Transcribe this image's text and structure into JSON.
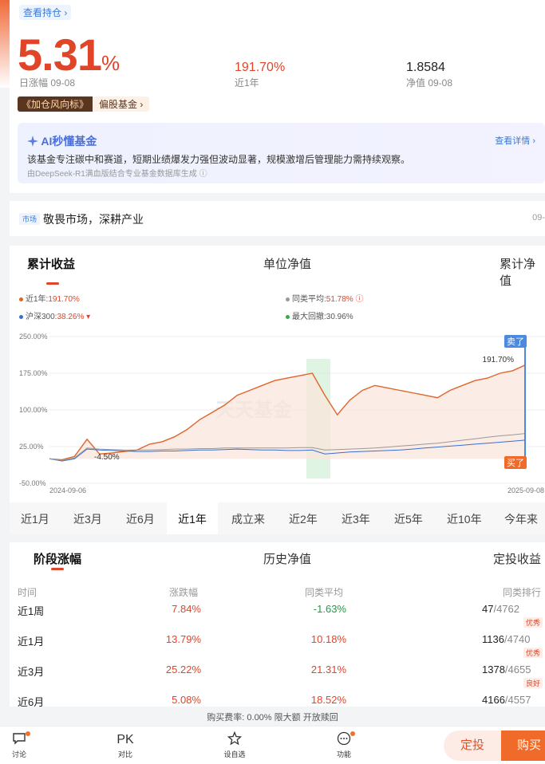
{
  "summary": {
    "view_holding": "查看持仓 ›",
    "daily_change": "5.31",
    "daily_change_unit": "%",
    "daily_label": "日涨幅 09-08",
    "year_return": "191.70%",
    "year_label": "近1年",
    "nav": "1.8584",
    "nav_label": "净值 09-08",
    "tag_dark": "《加仓风向标》",
    "tag_light": "偏股基金 ›"
  },
  "ai": {
    "title": "AI秒懂基金",
    "detail": "查看详情 ›",
    "text": "该基金专注碳中和赛道，短期业绩爆发力强但波动显著，规模激增后管理能力需持续观察。",
    "source": "由DeepSeek-R1满血版结合专业基金数据库生成 ⓘ"
  },
  "topic": {
    "tag": "市场",
    "text": "敬畏市场，深耕产业",
    "date": "09-"
  },
  "chart_tabs": [
    "累计收益",
    "单位净值",
    "累计净值"
  ],
  "legend": {
    "fund": "近1年:",
    "fund_val": "191.70%",
    "peer": "同类平均:",
    "peer_val": "51.78% ⓘ",
    "index": "沪深300:",
    "index_val": "38.26% ▾",
    "drawdown": "最大回撤:",
    "drawdown_val": "30.96%"
  },
  "chart_labels": {
    "sell": "卖了",
    "buy": "买了",
    "end_value": "191.70%",
    "low_value": "-4.50%",
    "watermark": "天天基金",
    "x_start": "2024-09-06",
    "x_end": "2025-09-08"
  },
  "chart_data": {
    "type": "line",
    "x": [
      "2024-09-06",
      "2025-09-08"
    ],
    "ylim": [
      -50,
      250
    ],
    "y_ticks": [
      "250.00%",
      "175.00%",
      "100.00%",
      "25.00%",
      "-50.00%"
    ],
    "series": [
      {
        "name": "近1年",
        "color": "#e0652a",
        "values": [
          0,
          -2,
          5,
          40,
          10,
          12,
          15,
          18,
          30,
          35,
          45,
          60,
          80,
          95,
          110,
          130,
          140,
          150,
          160,
          165,
          170,
          175,
          130,
          90,
          120,
          140,
          150,
          145,
          140,
          135,
          130,
          125,
          140,
          150,
          160,
          165,
          175,
          180,
          191.7
        ]
      },
      {
        "name": "沪深300",
        "color": "#3a6fd0",
        "values": [
          0,
          -4.5,
          0,
          20,
          18,
          17,
          16,
          15,
          15,
          16,
          16,
          17,
          18,
          18,
          19,
          20,
          19,
          18,
          18,
          17,
          17,
          18,
          10,
          12,
          14,
          15,
          16,
          17,
          18,
          20,
          22,
          24,
          26,
          28,
          30,
          32,
          34,
          36,
          38.26
        ]
      },
      {
        "name": "同类平均",
        "color": "#999999",
        "values": [
          0,
          -3,
          2,
          22,
          20,
          19,
          18,
          18,
          18,
          19,
          20,
          20,
          21,
          21,
          22,
          22,
          22,
          22,
          22,
          22,
          23,
          23,
          18,
          19,
          20,
          21,
          22,
          24,
          26,
          28,
          30,
          32,
          35,
          38,
          41,
          44,
          47,
          49,
          51.78
        ]
      }
    ]
  },
  "periods": [
    "近1月",
    "近3月",
    "近6月",
    "近1年",
    "成立来",
    "近2年",
    "近3年",
    "近5年",
    "近10年",
    "今年来"
  ],
  "returns": {
    "tabs": [
      "阶段涨幅",
      "历史净值",
      "定投收益"
    ],
    "headers": [
      "时间",
      "涨跌幅",
      "同类平均",
      "同类排行"
    ],
    "rows": [
      {
        "period": "近1周",
        "change": "7.84%",
        "avg": "-1.63%",
        "rank": "47",
        "total": "/4762",
        "badge": "优秀"
      },
      {
        "period": "近1月",
        "change": "13.79%",
        "avg": "10.18%",
        "rank": "1136",
        "total": "/4740",
        "badge": "优秀"
      },
      {
        "period": "近3月",
        "change": "25.22%",
        "avg": "21.31%",
        "rank": "1378",
        "total": "/4655",
        "badge": "良好"
      },
      {
        "period": "近6月",
        "change": "5.08%",
        "avg": "18.52%",
        "rank": "4166",
        "total": "/4557",
        "badge": ""
      }
    ]
  },
  "fee_line": "购买费率: 0.00% 限大额 开放赎回",
  "bottom_nav": {
    "discuss": "讨论",
    "compare_icon": "PK",
    "compare": "对比",
    "watch": "设自选",
    "function": "功能",
    "fixed": "定投",
    "buy": "购买"
  }
}
